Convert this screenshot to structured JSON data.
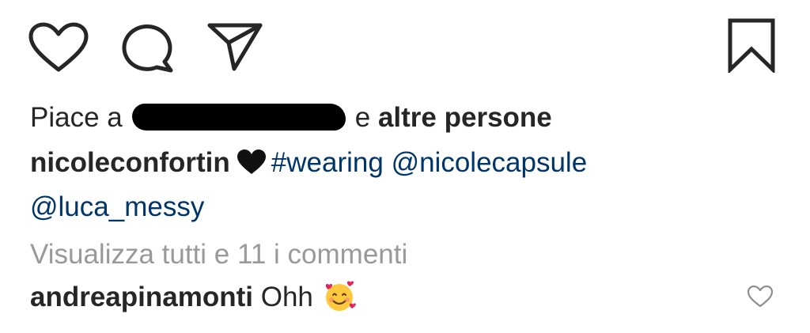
{
  "actions": {
    "like_icon": "heart-outline-icon",
    "comment_icon": "speech-bubble-icon",
    "share_icon": "paper-plane-icon",
    "save_icon": "bookmark-icon"
  },
  "likes": {
    "prefix": "Piace a",
    "suffix_plain": "e",
    "suffix_bold": "altre persone"
  },
  "caption": {
    "username": "nicoleconfortin",
    "emoji": "black-heart",
    "hashtag": "#wearing",
    "mention_1": "@nicolecapsule",
    "mention_2": "@luca_messy"
  },
  "view_all_comments": "Visualizza tutti e 11 i commenti",
  "comment": {
    "username": "andreapinamonti",
    "text": "Ohh",
    "emoji": "smiling-face-with-hearts"
  },
  "colors": {
    "text": "#262626",
    "link": "#003569",
    "muted": "#999999"
  }
}
